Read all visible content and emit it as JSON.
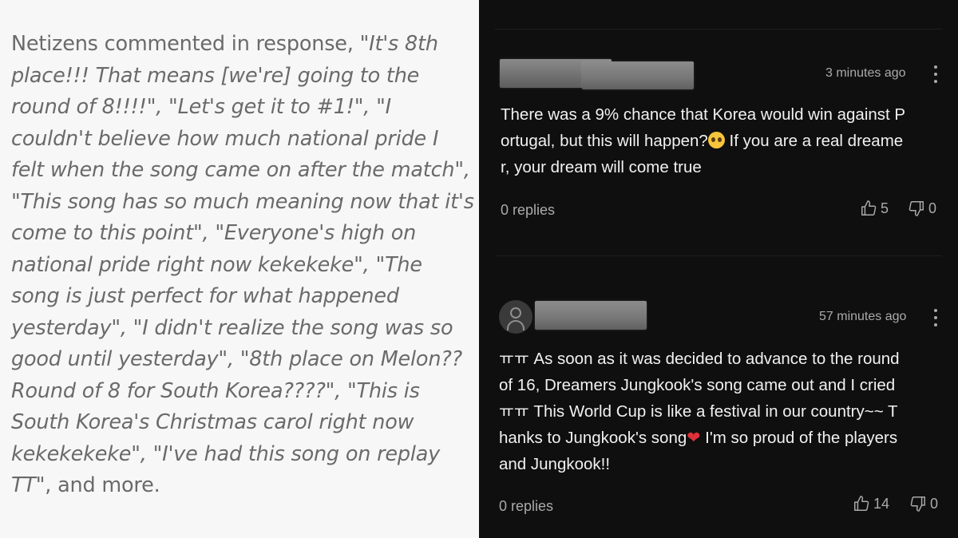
{
  "article": {
    "intro": "Netizens commented in response, ",
    "quotes": "\"It's 8th place!!! That means [we're] going to the round of 8!!!!\", \"Let's get it to #1!\", \"I couldn't believe how much national pride I felt when the song came on after the match\", \"This song has so much meaning now that it's come to this point\", \"Everyone's high on national pride right now kekekeke\", \"The song is just perfect for what happened yesterday\", \"I didn't realize the song was so good until yesterday\", \"8th place on Melon?? Round of 8 for South Korea????\", \"This is South Korea's Christmas carol right now kekekekeke\", \"I've had this song on replay TT\"",
    "outro": ", and more."
  },
  "comments": [
    {
      "time": "3 minutes ago",
      "lines": [
        "There was a 9% chance that Korea would win against P",
        "ortugal, but this will happen?",
        " If you are a real dreame",
        "r, your dream will come true"
      ],
      "replies": "0 replies",
      "likes": "5",
      "dislikes": "0"
    },
    {
      "time": "57 minutes ago",
      "lines": [
        "ㅠㅠ As soon as it was decided to advance to the round",
        "of 16, Dreamers Jungkook's song came out and I cried",
        "ㅠㅠ This World Cup is like a festival in our country~~ T",
        "hanks to Jungkook's song",
        "❤",
        " I'm so proud of the players",
        "and Jungkook!!"
      ],
      "replies": "0 replies",
      "likes": "14",
      "dislikes": "0"
    }
  ],
  "icons": {
    "like": "thumbs-up-icon",
    "dislike": "thumbs-down-icon",
    "more": "more-vertical-icon",
    "avatar": "default-avatar-icon",
    "emoji": "crying-face-emoji",
    "heart": "red-heart-emoji"
  },
  "colors": {
    "left_bg": "#f7f7f7",
    "article_text": "#6a6a6a",
    "right_bg": "#0f0f0f",
    "comment_text": "#f1f1f1",
    "meta_text": "#aaaaaa",
    "heart": "#e0313a"
  }
}
